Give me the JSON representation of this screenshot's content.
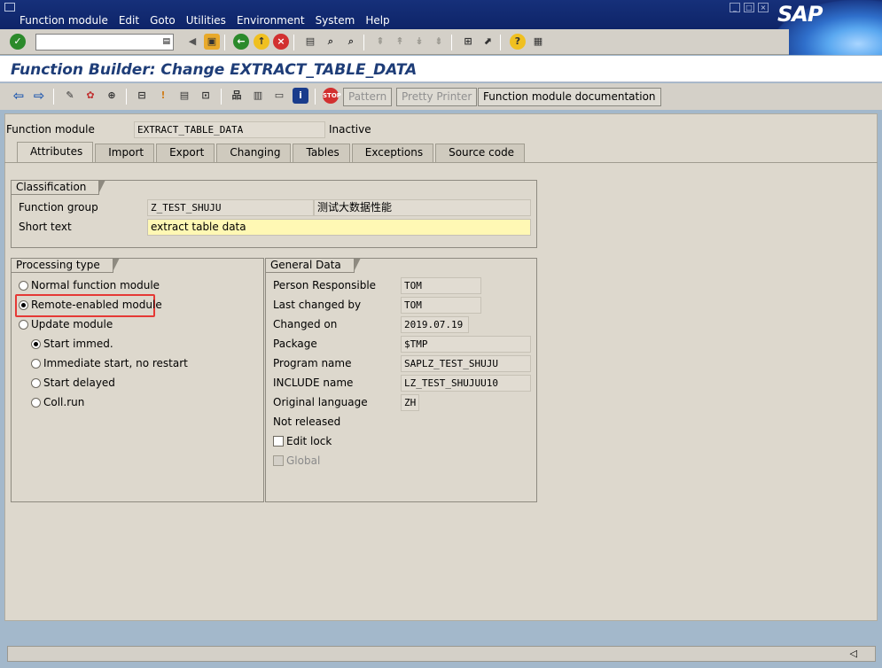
{
  "menu": [
    "Function module",
    "Edit",
    "Goto",
    "Utilities",
    "Environment",
    "System",
    "Help"
  ],
  "brand": "SAP",
  "title": "Function Builder: Change EXTRACT_TABLE_DATA",
  "app_toolbar": {
    "pattern": "Pattern",
    "pretty_printer": "Pretty Printer",
    "documentation": "Function module documentation"
  },
  "function_module": {
    "label": "Function module",
    "value": "EXTRACT_TABLE_DATA",
    "status": "Inactive"
  },
  "tabs": [
    "Attributes",
    "Import",
    "Export",
    "Changing",
    "Tables",
    "Exceptions",
    "Source code"
  ],
  "classification": {
    "title": "Classification",
    "function_group_label": "Function group",
    "function_group_value": "Z_TEST_SHUJU",
    "function_group_desc": "测试大数据性能",
    "short_text_label": "Short text",
    "short_text_value": "extract table data"
  },
  "processing_type": {
    "title": "Processing type",
    "options": [
      "Normal function module",
      "Remote-enabled module",
      "Update module"
    ],
    "selected": "Remote-enabled module",
    "update_options": [
      "Start immed.",
      "Immediate start, no restart",
      "Start delayed",
      "Coll.run"
    ],
    "update_selected": "Start immed."
  },
  "general_data": {
    "title": "General Data",
    "person_responsible_label": "Person Responsible",
    "person_responsible": "TOM",
    "last_changed_by_label": "Last changed by",
    "last_changed_by": "TOM",
    "changed_on_label": "Changed on",
    "changed_on": "2019.07.19",
    "package_label": "Package",
    "package": "$TMP",
    "program_name_label": "Program name",
    "program_name": "SAPLZ_TEST_SHUJU",
    "include_name_label": "INCLUDE name",
    "include_name": "LZ_TEST_SHUJUU10",
    "original_language_label": "Original language",
    "original_language": "ZH",
    "not_released": "Not released",
    "edit_lock": "Edit lock",
    "global": "Global"
  },
  "colors": {
    "menubar": "#0e2468",
    "title": "#1e3d78",
    "highlight": "#e53935",
    "short_text_bg": "#fff8b4"
  }
}
